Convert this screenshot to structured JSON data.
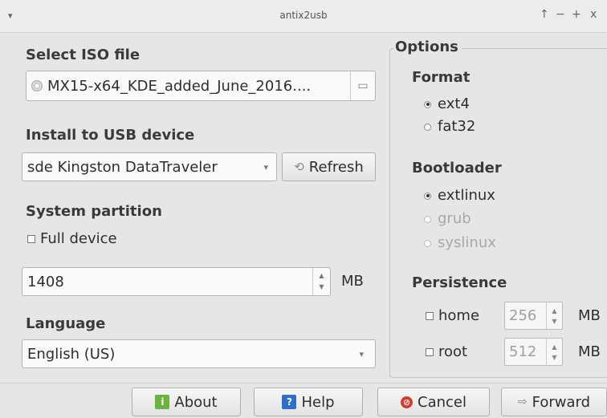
{
  "window": {
    "title": "antix2usb",
    "menu_glyph": "▾",
    "btn_up": "↑",
    "btn_min": "−",
    "btn_max": "+",
    "btn_close": "x"
  },
  "iso": {
    "heading": "Select ISO file",
    "value": "MX15-x64_KDE_added_June_2016...."
  },
  "usb": {
    "heading": "Install to USB device",
    "device": "sde Kingston DataTraveler",
    "refresh_label": "Refresh"
  },
  "partition": {
    "heading": "System partition",
    "full_device_label": "Full device",
    "size_value": "1408",
    "unit": "MB"
  },
  "language": {
    "heading": "Language",
    "value": "English (US)"
  },
  "options": {
    "heading": "Options",
    "format": {
      "heading": "Format",
      "items": [
        "ext4",
        "fat32"
      ],
      "selected": "ext4"
    },
    "bootloader": {
      "heading": "Bootloader",
      "items": [
        "extlinux",
        "grub",
        "syslinux"
      ],
      "selected": "extlinux",
      "disabled": [
        "grub",
        "syslinux"
      ]
    },
    "persistence": {
      "heading": "Persistence",
      "home": {
        "label": "home",
        "value": "256",
        "unit": "MB"
      },
      "root": {
        "label": "root",
        "value": "512",
        "unit": "MB"
      }
    }
  },
  "footer": {
    "about": "About",
    "help": "Help",
    "cancel": "Cancel",
    "forward": "Forward"
  },
  "colors": {
    "about_icon": "#6db33f",
    "help_icon": "#2a6fc9",
    "cancel_icon": "#d6392b"
  }
}
